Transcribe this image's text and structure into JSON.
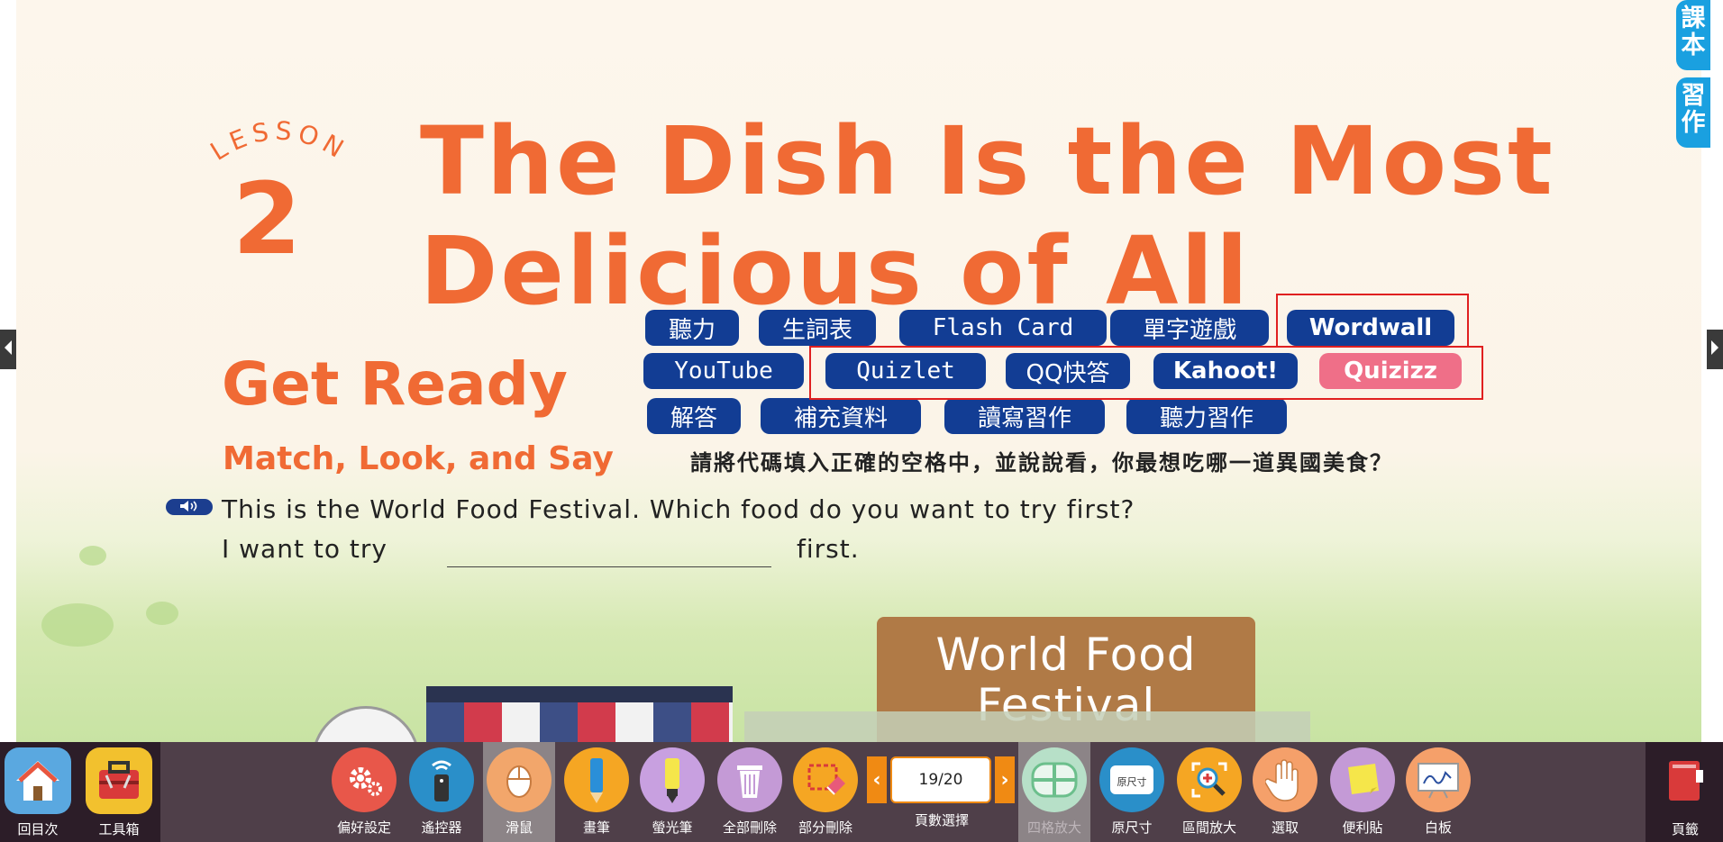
{
  "page": {
    "lesson_word": "LESSON",
    "lesson_number": "2",
    "title_line1": "The Dish Is the Most",
    "title_line2": "Delicious of All",
    "get_ready": "Get Ready",
    "subheading": "Match, Look, and Say",
    "instruction": "請將代碼填入正確的空格中，並說說看，你最想吃哪一道異國美食？",
    "sentence1": "This is the World Food Festival. Which food do you want to try first?",
    "sentence2_start": "I want to try",
    "sentence2_end": "first.",
    "sign_line1": "World Food",
    "sign_line2": "Festival"
  },
  "resources": {
    "row1": [
      "聽力",
      "生詞表",
      "Flash Card",
      "單字遊戲",
      "Wordwall"
    ],
    "row2": [
      "YouTube",
      "Quizlet",
      "QQ快答",
      "Kahoot!",
      "Quizizz"
    ],
    "row3": [
      "解答",
      "補充資料",
      "讀寫習作",
      "聽力習作"
    ]
  },
  "side_tabs": [
    "課本",
    "習作"
  ],
  "toolbar": {
    "home": "回目次",
    "toolbox": "工具箱",
    "preferences": "偏好設定",
    "remote": "遙控器",
    "mouse": "滑鼠",
    "pen": "畫筆",
    "highlighter": "螢光筆",
    "delete_all": "全部刪除",
    "partial_delete": "部分刪除",
    "page_value": "19/20",
    "page_select": "頁數選擇",
    "quad_zoom": "四格放大",
    "original_size": "原尺寸",
    "original_size_icon_text": "原尺寸",
    "area_zoom": "區間放大",
    "select": "選取",
    "sticky_note": "便利貼",
    "whiteboard": "白板",
    "bookmark": "頁籤"
  },
  "colors": {
    "accent_orange": "#f06a34",
    "button_navy": "#123d94",
    "button_pink": "#ef6f88",
    "highlight_red": "#e02020",
    "toolbar_bg": "#4f3f49",
    "tab_blue": "#1aa0e0"
  }
}
